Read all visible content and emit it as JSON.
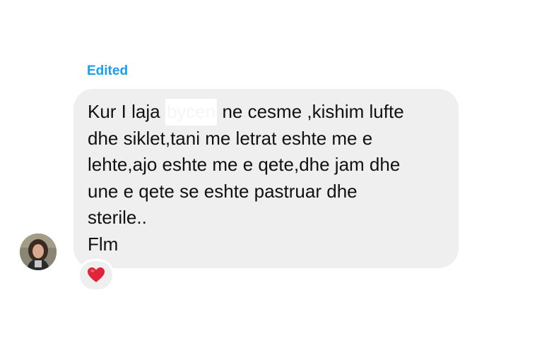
{
  "status": {
    "edited_label": "Edited"
  },
  "message": {
    "part_before": "Kur I laja ",
    "redacted_text": "bycen",
    "part_after": " ne cesme ,kishim lufte\ndhe siklet,tani me letrat eshte me e\nlehte,ajo eshte me e qete,dhe jam dhe\nune e qete se eshte pastruar dhe\nsterile..\nFlm",
    "bubble_color": "#efefef"
  },
  "reaction": {
    "icon": "heart-icon",
    "color": "#e0243a"
  },
  "avatar": {
    "icon": "user-avatar"
  }
}
